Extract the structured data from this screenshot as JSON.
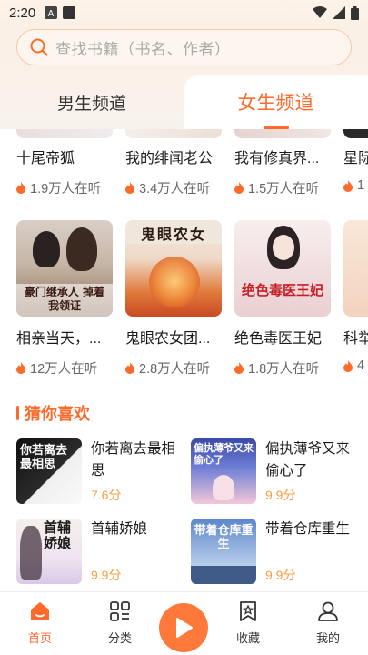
{
  "status_bar": {
    "time": "2:20"
  },
  "search": {
    "placeholder": "查找书籍（书名、作者）"
  },
  "tabs": {
    "male": "男生频道",
    "female": "女生频道"
  },
  "grid_row1": [
    {
      "title": "十尾帝狐",
      "readers": "1.9万人在听"
    },
    {
      "title": "我的绯闻老公",
      "readers": "3.4万人在听"
    },
    {
      "title": "我有修真界...",
      "readers": "1.5万人在听"
    },
    {
      "title": "星际",
      "readers": "1"
    }
  ],
  "grid_row2": [
    {
      "title": "相亲当天，...",
      "readers": "12万人在听",
      "cover_text": "豪门继承人 掉着我领证"
    },
    {
      "title": "鬼眼农女团...",
      "readers": "2.8万人在听",
      "cover_text": "鬼眼农女"
    },
    {
      "title": "绝色毒医王妃",
      "readers": "1.8万人在听",
      "cover_text": "绝色毒医王妃"
    },
    {
      "title": "科举",
      "readers": "4"
    }
  ],
  "section": {
    "title": "猜你喜欢"
  },
  "recommendations": [
    {
      "title": "你若离去最相思",
      "score": "7.6分",
      "cover_text": "你若离去最相思"
    },
    {
      "title": "偏执薄爷又来偷心了",
      "score": "9.9分",
      "cover_text": "偏执薄爷又来偷心了"
    },
    {
      "title": "首辅娇娘",
      "score": "9.9分",
      "cover_text": "首辅娇娘"
    },
    {
      "title": "带着仓库重生",
      "score": "9.9分",
      "cover_text": "带着仓库重生"
    }
  ],
  "bottom_nav": {
    "home": "首页",
    "category": "分类",
    "favorites": "收藏",
    "mine": "我的"
  },
  "colors": {
    "accent": "#ff6a2b",
    "score": "#f5a142"
  }
}
